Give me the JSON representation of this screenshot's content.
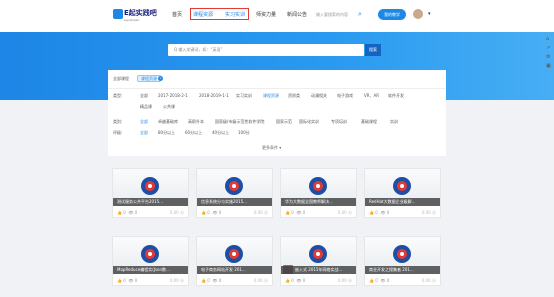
{
  "header": {
    "logo_text": "E起实践吧",
    "logo_sub": "eqi-shijian",
    "nav": [
      "首页",
      "课程资源",
      "实习实训",
      "师资力量",
      "新闻公告"
    ],
    "nav_active_index": 1,
    "search_placeholder": "输入要搜索的内容",
    "login_label": "我的教学",
    "caret": "▾"
  },
  "hero": {
    "search_placeholder": "Q  输入关键词，如：“英语”",
    "search_button": "搜索"
  },
  "filters": {
    "all_label": "全部课程",
    "chip": "课程资源",
    "rows": [
      {
        "label": "类型:",
        "items": [
          "全部",
          "2017-2018-2-1",
          "2018-2019-1-1",
          "实习实训",
          "课程资源",
          "资质类",
          "动漫相关",
          "电子游戏",
          "VR、AR",
          "软件开发"
        ]
      },
      {
        "label": "",
        "items": [
          "精品课",
          "公共课"
        ]
      },
      {
        "label": "类别:",
        "items": [
          "全部",
          "卓越基础库",
          "高职升本",
          "国家级/市级示范性软件学院",
          "国家示范",
          "国际化实训",
          "专项培训",
          "基础课程",
          "实训"
        ]
      },
      {
        "label": "评级:",
        "items": [
          "全部",
          "80分以上",
          "60分以上",
          "40分以上",
          "100分"
        ]
      }
    ],
    "more": "更多条件 ▾"
  },
  "cards": [
    {
      "title": "测试服务公共平台2015...",
      "likes": "0",
      "views": "0",
      "score": "0.00 分"
    },
    {
      "title": "信息系统分与实施2015...",
      "likes": "0",
      "views": "0",
      "score": "0.00 分"
    },
    {
      "title": "华为大数据全国教师解决...",
      "likes": "0",
      "views": "0",
      "score": "0.00 分"
    },
    {
      "title": "RedHat大数据企业级解...",
      "likes": "0",
      "views": "0",
      "score": "0.00 分"
    },
    {
      "title": "MapReduce编程实(Json数...",
      "likes": "0",
      "views": "0",
      "score": "0.00 分"
    },
    {
      "title": "电子商务网站开发 201...",
      "likes": "0",
      "views": "0",
      "score": "0.00 分"
    },
    {
      "title": "嵌入式 2015年网络实战...",
      "likes": "0",
      "views": "0",
      "score": "0.00 分"
    },
    {
      "title": "商业开发之搜集者 201...",
      "likes": "0",
      "views": "0",
      "score": "0.00 分"
    }
  ],
  "sidebar_icons": [
    "home-icon",
    "share-icon",
    "settings-icon",
    "qr-icon"
  ],
  "colors": {
    "primary": "#1e88e5",
    "highlight_box": "#e53935",
    "hero": "#1d86e6"
  }
}
